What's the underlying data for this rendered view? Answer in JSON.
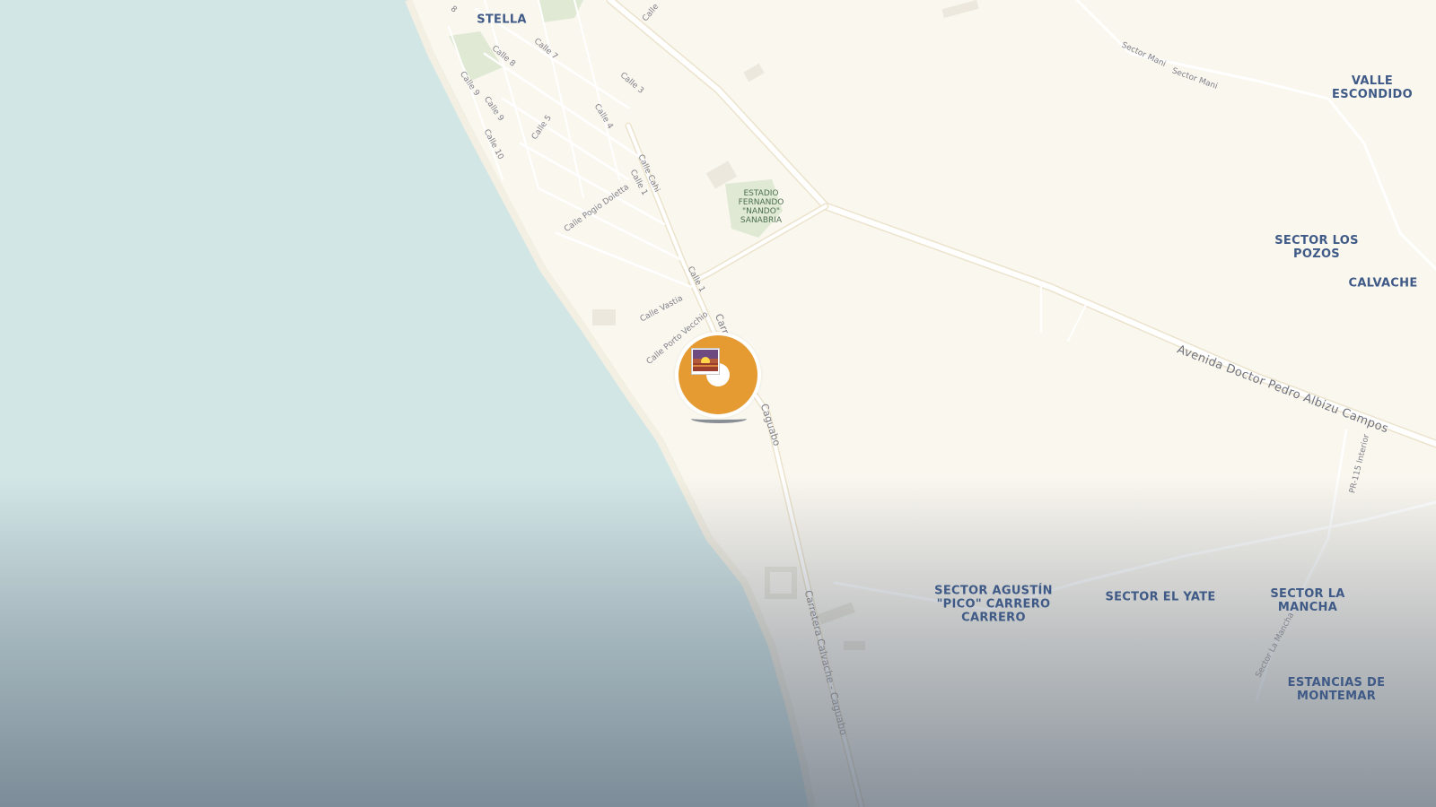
{
  "map": {
    "colors": {
      "land": "#faf7ef",
      "water": "#d3e6e6",
      "road": "#ffffff",
      "road_casing": "#ece3cc",
      "building": "#ece8dd",
      "park": "#dfe9d3",
      "area_label": "#3f5a86",
      "street_label": "#7e7f88",
      "marker": "#e59a32"
    },
    "area_labels": [
      {
        "id": "stella",
        "text": "STELLA"
      },
      {
        "id": "valle",
        "text": "VALLE\nESCONDIDO"
      },
      {
        "id": "los-pozos",
        "text": "SECTOR LOS\nPOZOS"
      },
      {
        "id": "calvache",
        "text": "CALVACHE"
      },
      {
        "id": "agustin",
        "text": "SECTOR AGUSTÍN\n\"PICO\" CARRERO\nCARRERO"
      },
      {
        "id": "el-yate",
        "text": "SECTOR EL YATE"
      },
      {
        "id": "la-mancha",
        "text": "SECTOR LA\nMANCHA"
      },
      {
        "id": "montemar",
        "text": "ESTANCIAS DE\nMONTEMAR"
      }
    ],
    "poi_labels": [
      {
        "id": "estadio",
        "text": "ESTADIO\nFERNANDO\n\"NANDO\"\nSANABRIA"
      }
    ],
    "street_labels": [
      {
        "id": "avenida",
        "text": "Avenida Doctor Pedro Albizu Campos"
      },
      {
        "id": "carretera",
        "text": "Carretera Calvache - Caguabo"
      },
      {
        "id": "caguabo",
        "text": "Caguabo"
      },
      {
        "id": "carr",
        "text": "Carr"
      },
      {
        "id": "calle-1",
        "text": "Calle 1"
      },
      {
        "id": "calle-1b",
        "text": "Calle 1"
      },
      {
        "id": "calle-3",
        "text": "Calle 3"
      },
      {
        "id": "calle-4",
        "text": "Calle 4"
      },
      {
        "id": "calle-5",
        "text": "Calle 5"
      },
      {
        "id": "calle-7",
        "text": "Calle 7"
      },
      {
        "id": "calle-8",
        "text": "Calle 8"
      },
      {
        "id": "calle-9a",
        "text": "Calle 9"
      },
      {
        "id": "calle-9b",
        "text": "Calle 9"
      },
      {
        "id": "calle-10",
        "text": "Calle 10"
      },
      {
        "id": "calle-cahi",
        "text": "Calle Cahi"
      },
      {
        "id": "calle-top",
        "text": "Calle"
      },
      {
        "id": "calle-8-top",
        "text": "8"
      },
      {
        "id": "pogio",
        "text": "Calle Pogio Doletta"
      },
      {
        "id": "vastia",
        "text": "Calle Vastia"
      },
      {
        "id": "porto",
        "text": "Calle Porto Vecchio"
      },
      {
        "id": "mani1",
        "text": "Sector Mani"
      },
      {
        "id": "mani2",
        "text": "Sector Mani"
      },
      {
        "id": "pr115",
        "text": "PR-115 Interior"
      },
      {
        "id": "la-mancha-rd",
        "text": "Sector La Mancha"
      }
    ],
    "marker": {
      "icon": "photo-icon",
      "shape": "donut-pin"
    }
  }
}
